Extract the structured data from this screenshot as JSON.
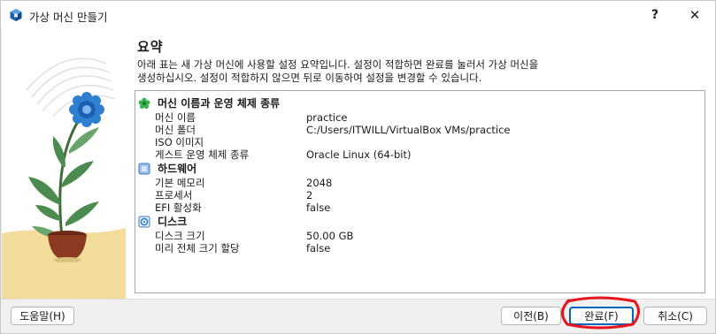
{
  "window": {
    "title": "가상 머신 만들기",
    "help_glyph": "?",
    "close_glyph": "✕"
  },
  "page": {
    "heading": "요약",
    "description_line1": "아래 표는 새 가상 머신에 사용할 설정 요약입니다. 설정이 적합하면 완료를 눌러서 가상 머신을",
    "description_line2": "생성하십시오. 설정이 적합하지 않으면 뒤로 이동하여 설정을 변경할 수 있습니다."
  },
  "summary": {
    "machine": {
      "title": "머신 이름과 운영 체제 종류",
      "icon": "green-star-icon",
      "rows": [
        {
          "key": "머신 이름",
          "value": "practice"
        },
        {
          "key": "머신 폴더",
          "value": "C:/Users/ITWILL/VirtualBox VMs/practice"
        },
        {
          "key": "ISO 이미지",
          "value": ""
        },
        {
          "key": "게스트 운영 체제 종류",
          "value": "Oracle Linux (64-bit)"
        }
      ]
    },
    "hardware": {
      "title": "하드웨어",
      "icon": "chip-icon",
      "rows": [
        {
          "key": "기본 메모리",
          "value": "2048"
        },
        {
          "key": "프로세서",
          "value": "2"
        },
        {
          "key": "EFI 활성화",
          "value": "false"
        }
      ]
    },
    "disk": {
      "title": "디스크",
      "icon": "disk-icon",
      "rows": [
        {
          "key": "디스크 크기",
          "value": "50.00 GB"
        },
        {
          "key": "미리 전체 크기 할당",
          "value": "false"
        }
      ]
    }
  },
  "footer": {
    "help_label": "도움말(H)",
    "back_label": "이전(B)",
    "finish_label": "완료(F)",
    "cancel_label": "취소(C)"
  },
  "colors": {
    "accent": "#0067c0",
    "annotation": "#e8141e",
    "flower": "#2f7fd1",
    "pot": "#8c3a22",
    "sand": "#f3dd9a"
  }
}
